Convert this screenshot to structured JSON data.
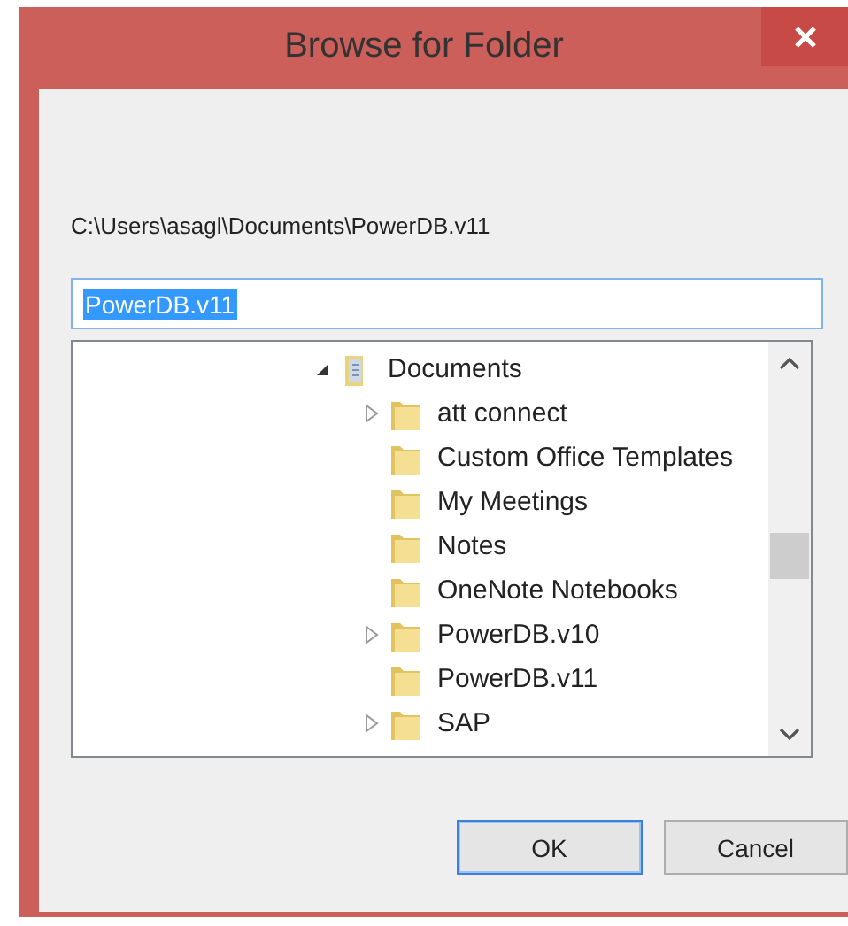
{
  "window": {
    "title": "Browse for Folder"
  },
  "path_label": "C:\\Users\\asagl\\Documents\\PowerDB.v11",
  "folder_field": {
    "value": "PowerDB.v11",
    "selected": true
  },
  "tree": [
    {
      "label": "Documents",
      "kind": "library",
      "has_children": true,
      "expanded": true,
      "children": [
        {
          "label": "att connect",
          "kind": "folder",
          "has_children": true,
          "expanded": false
        },
        {
          "label": "Custom Office Templates",
          "kind": "folder",
          "has_children": false
        },
        {
          "label": "My Meetings",
          "kind": "folder",
          "has_children": false
        },
        {
          "label": "Notes",
          "kind": "folder",
          "has_children": false
        },
        {
          "label": "OneNote Notebooks",
          "kind": "folder",
          "has_children": false
        },
        {
          "label": "PowerDB.v10",
          "kind": "folder",
          "has_children": true,
          "expanded": false
        },
        {
          "label": "PowerDB.v11",
          "kind": "folder",
          "has_children": false
        },
        {
          "label": "SAP",
          "kind": "folder",
          "has_children": true,
          "expanded": false
        }
      ]
    }
  ],
  "buttons": [
    {
      "label": "OK",
      "default": true
    },
    {
      "label": "Cancel",
      "default": false
    }
  ]
}
